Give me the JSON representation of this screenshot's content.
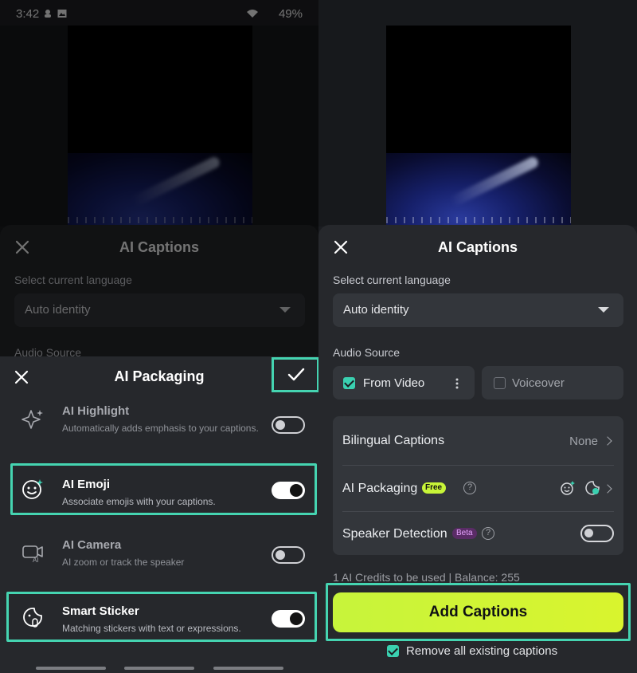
{
  "status_bar": {
    "time": "3:42",
    "battery": "49%"
  },
  "ai_captions": {
    "title": "AI Captions",
    "language_label": "Select current language",
    "language_value": "Auto identity",
    "audio_source_label": "Audio Source",
    "sources": [
      {
        "label": "From Video",
        "checked": true
      },
      {
        "label": "Voiceover",
        "checked": false
      }
    ],
    "options": {
      "bilingual": {
        "label": "Bilingual Captions",
        "value": "None"
      },
      "packaging": {
        "label": "AI Packaging",
        "badge": "Free"
      },
      "speaker": {
        "label": "Speaker Detection",
        "badge": "Beta",
        "enabled": false
      }
    },
    "credits_text": "1 AI Credits to be used | Balance: 255",
    "add_button": "Add Captions",
    "remove_label": "Remove all existing captions",
    "remove_checked": true
  },
  "ai_packaging": {
    "title": "AI Packaging",
    "items": [
      {
        "title": "AI Highlight",
        "subtitle": "Automatically adds emphasis to your captions.",
        "enabled": false,
        "icon": "sparkle-icon"
      },
      {
        "title": "AI Emoji",
        "subtitle": "Associate emojis with your captions.",
        "enabled": true,
        "icon": "emoji-icon"
      },
      {
        "title": "AI Camera",
        "subtitle": "AI zoom or track the speaker",
        "enabled": false,
        "icon": "ai-camera-icon"
      },
      {
        "title": "Smart Sticker",
        "subtitle": "Matching stickers with text or expressions.",
        "enabled": true,
        "icon": "sticker-icon"
      }
    ]
  },
  "colors": {
    "accent": "#45d4b1",
    "button": "#cff43a",
    "sheet": "#26282c"
  }
}
